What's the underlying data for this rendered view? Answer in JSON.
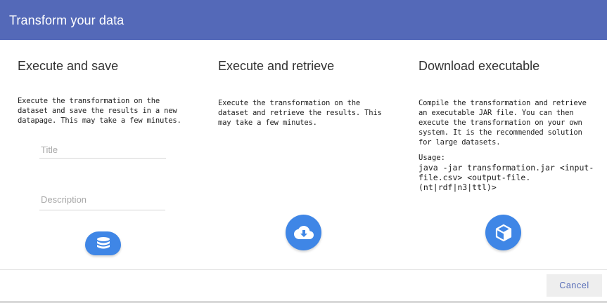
{
  "dialog": {
    "title": "Transform your data"
  },
  "columns": [
    {
      "title": "Execute and save",
      "description": "Execute the transformation on the dataset and save the results in a new datapage. This may take a few minutes.",
      "title_field_placeholder": "Title",
      "description_field_placeholder": "Description",
      "icon": "database-icon"
    },
    {
      "title": "Execute and retrieve",
      "description": "Execute the transformation on the dataset and retrieve the results. This may take a few minutes.",
      "icon": "cloud-download-icon"
    },
    {
      "title": "Download executable",
      "description": "Compile the transformation and retrieve an executable JAR file. You can then execute the transformation on your own system. It is the recommended solution for large datasets.",
      "usage_label": "Usage:",
      "usage_command": "java -jar transformation.jar <input-file.csv> <output-file.(nt|rdf|n3|ttl)>",
      "icon": "cube-icon"
    }
  ],
  "footer": {
    "cancel_label": "Cancel"
  },
  "colors": {
    "header": "#5469b8",
    "accent_button": "#3f86e6",
    "cancel_text": "#5a6fb8"
  }
}
